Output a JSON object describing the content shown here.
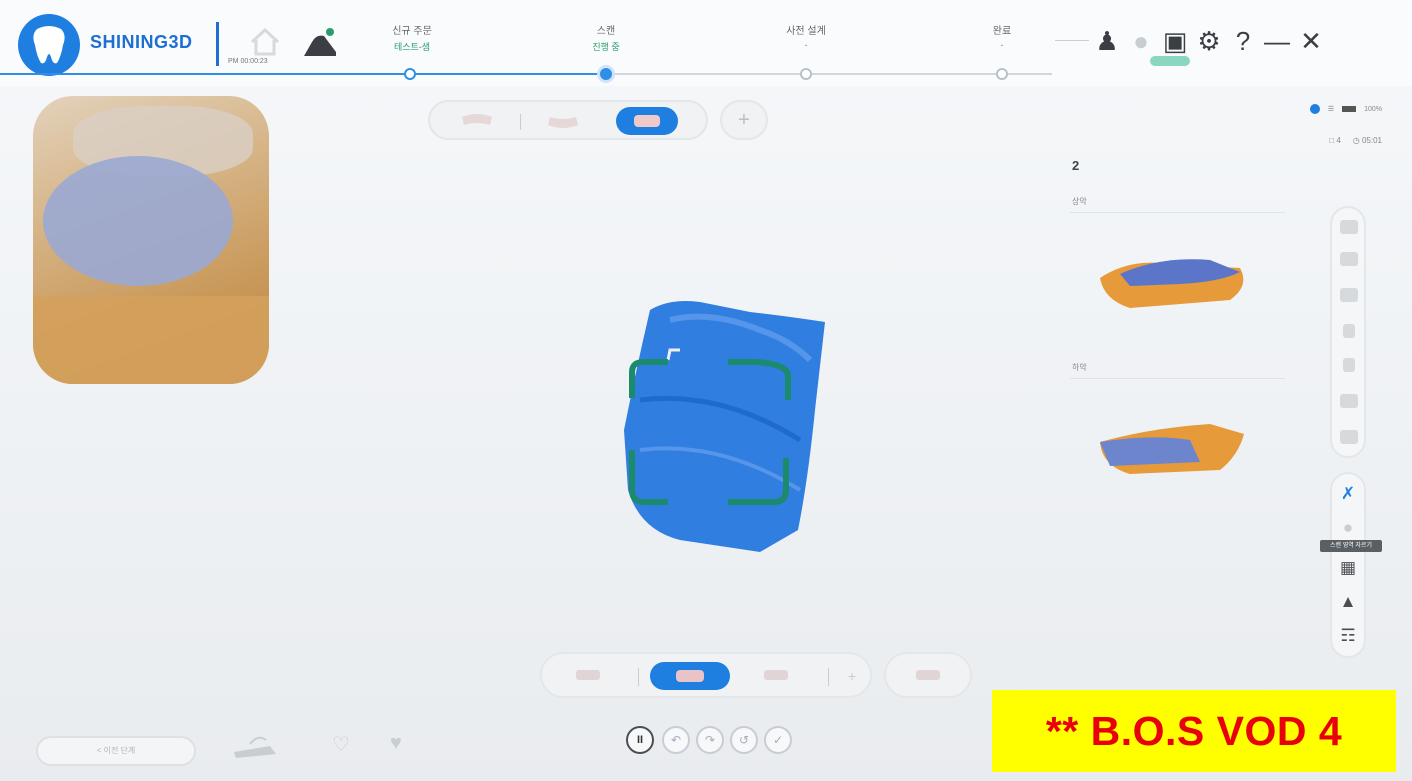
{
  "header": {
    "brand": "SHINING3D",
    "session_time": "PM 00:00:23",
    "steps": [
      {
        "label": "신규 주문",
        "sub": "테스트-샘"
      },
      {
        "label": "스캔",
        "sub": "진행 중"
      },
      {
        "label": "사전 설계",
        "sub": "-"
      },
      {
        "label": "완료",
        "sub": "-"
      }
    ],
    "icons": [
      "user-icon",
      "power-icon",
      "screen-icon",
      "gear-icon",
      "help-icon",
      "minimize-icon",
      "close-icon"
    ]
  },
  "status": {
    "battery": "100%",
    "count": "4",
    "timer": "05:01"
  },
  "panel": {
    "title": "2",
    "upper_label": "상악",
    "lower_label": "하악"
  },
  "tooltip": "스캔 영역 자르기",
  "bottom": {
    "prev_label": "< 이전 단계",
    "pause": "II"
  },
  "watermark": "** B.O.S VOD 4",
  "colors": {
    "accent": "#1f7fe0",
    "scan_blue": "#2f7ee0",
    "scan_frame": "#1c8a6c",
    "watermark_bg": "#ffff00",
    "watermark_text": "#e8000b"
  }
}
